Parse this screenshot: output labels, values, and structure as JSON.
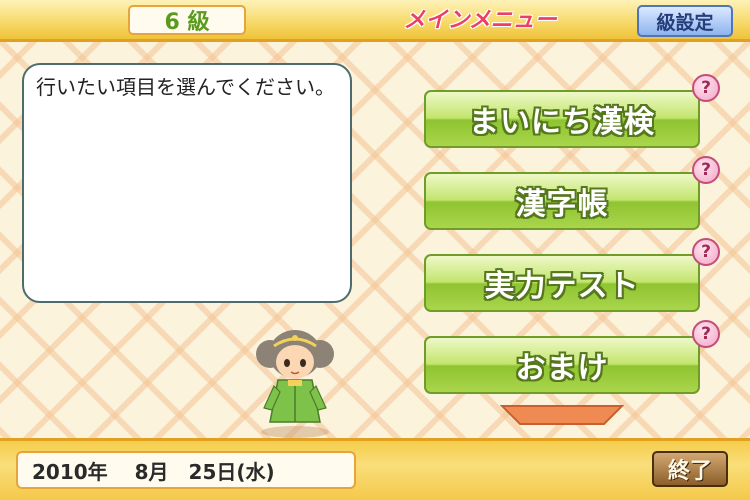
{
  "header": {
    "grade": "6 級",
    "title": "メインメニュー",
    "grade_settings_label": "級設定"
  },
  "dialog": {
    "message": "行いたい項目を選んでください。"
  },
  "menu": {
    "items": [
      {
        "label": "まいにち漢検",
        "help": "?"
      },
      {
        "label": "漢字帳",
        "help": "?"
      },
      {
        "label": "実力テスト",
        "help": "?"
      },
      {
        "label": "おまけ",
        "help": "?"
      }
    ],
    "scroll_icon": "scroll-down-arrow"
  },
  "footer": {
    "date": "2010年　 8月　25日(水)",
    "quit_label": "終了"
  },
  "colors": {
    "accent_green": "#8fc431",
    "title_pink": "#ec3f63",
    "bar_gold": "#f7d866"
  }
}
